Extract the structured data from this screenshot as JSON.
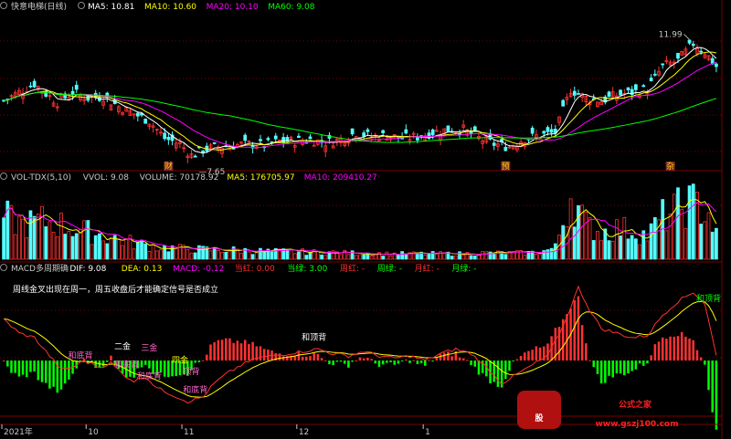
{
  "colors": {
    "bg": "#000000",
    "up": "#ff3232",
    "down": "#54fcfc",
    "grid": "#7a0000",
    "ma5": "#ffffff",
    "ma10": "#ffff00",
    "ma20": "#ff00ff",
    "ma60": "#00ff00",
    "dif": "#ffffff",
    "dea": "#ffff00"
  },
  "header_main": {
    "title": "快意电梯(日线)",
    "items": [
      {
        "text": "MA5: 10.81",
        "color": "#ffffff"
      },
      {
        "text": "MA10: 10.60",
        "color": "#ffff00"
      },
      {
        "text": "MA20: 10.10",
        "color": "#ff00ff"
      },
      {
        "text": "MA60: 9.08",
        "color": "#00ff00"
      }
    ]
  },
  "header_vol": {
    "items": [
      {
        "text": "VOL-TDX(5,10)",
        "color": "#c8c8c8"
      },
      {
        "text": "VVOL: 9.08",
        "color": "#c8c8c8"
      },
      {
        "text": "VOLUME: 70178.92",
        "color": "#c8c8c8"
      },
      {
        "text": "MA5: 176705.97",
        "color": "#ffff00"
      },
      {
        "text": "MA10: 209410.27",
        "color": "#ff00ff"
      }
    ]
  },
  "header_macd": {
    "items": [
      {
        "text": "MACD多周期确",
        "color": "#c8c8c8"
      },
      {
        "text": "DIF: 9.08",
        "color": "#ffffff"
      },
      {
        "text": "DEA: 0.13",
        "color": "#ffff00"
      },
      {
        "text": "MACD: -0.12",
        "color": "#ff00ff"
      },
      {
        "text": "当红: 0.00",
        "color": "#ff3232"
      },
      {
        "text": "当绿: 3.00",
        "color": "#00ff00"
      },
      {
        "text": "周红: -",
        "color": "#ff3232"
      },
      {
        "text": "周绿: -",
        "color": "#00ff00"
      },
      {
        "text": "月红: -",
        "color": "#ff3232"
      },
      {
        "text": "月绿: -",
        "color": "#00ff00"
      }
    ]
  },
  "macd_note": "周线金叉出现在周一，周五收盘后才能确定信号是否成立",
  "price_annotations": {
    "high": "11.99",
    "low": "7.65"
  },
  "event_markers": [
    {
      "label": "财",
      "i": 43
    },
    {
      "label": "预",
      "i": 131
    },
    {
      "label": "杂",
      "i": 174
    }
  ],
  "signal_labels": [
    {
      "text": "二金",
      "i": 31,
      "v": 0.5,
      "color": "#ffffff"
    },
    {
      "text": "三金",
      "i": 38,
      "v": 0.45,
      "color": "#ff66cc"
    },
    {
      "text": "四金",
      "i": 46,
      "v": -0.1,
      "color": "#ffff00"
    },
    {
      "text": "顶背",
      "i": 49,
      "v": -0.6,
      "color": "#ff66cc"
    },
    {
      "text": "和底背",
      "i": 20,
      "v": 0.1,
      "color": "#ff66cc"
    },
    {
      "text": "和底背",
      "i": 32,
      "v": -0.3,
      "color": "#ff66cc"
    },
    {
      "text": "和底背",
      "i": 38,
      "v": -0.8,
      "color": "#ff66cc"
    },
    {
      "text": "和底背",
      "i": 50,
      "v": -1.4,
      "color": "#ff66cc"
    },
    {
      "text": "和顶背",
      "i": 81,
      "v": 0.9,
      "color": "#ffffff"
    },
    {
      "text": "和顶背",
      "i": 184,
      "v": 2.6,
      "color": "#00ff00"
    }
  ],
  "date_axis": [
    {
      "label": "2021年",
      "i": 0
    },
    {
      "label": "10",
      "i": 22
    },
    {
      "label": "11",
      "i": 47
    },
    {
      "label": "12",
      "i": 77
    },
    {
      "label": "1",
      "i": 110
    }
  ],
  "watermark": {
    "badge": "股",
    "text": "公式之家",
    "url": "www.gszj100.com"
  },
  "chart_data": {
    "type": "candlestick",
    "n": 187,
    "price_ylim": [
      7.2,
      12.6
    ],
    "price_knots": [
      [
        0,
        9.6
      ],
      [
        4,
        9.9
      ],
      [
        8,
        10.2
      ],
      [
        11,
        9.85
      ],
      [
        14,
        9.55
      ],
      [
        18,
        9.9
      ],
      [
        22,
        9.7
      ],
      [
        26,
        9.75
      ],
      [
        30,
        9.4
      ],
      [
        34,
        9.15
      ],
      [
        38,
        8.9
      ],
      [
        42,
        8.3
      ],
      [
        46,
        8.1
      ],
      [
        49,
        7.7
      ],
      [
        52,
        7.9
      ],
      [
        56,
        8.0
      ],
      [
        60,
        8.05
      ],
      [
        64,
        8.1
      ],
      [
        68,
        8.05
      ],
      [
        72,
        8.2
      ],
      [
        76,
        8.2
      ],
      [
        80,
        8.25
      ],
      [
        84,
        8.15
      ],
      [
        88,
        8.25
      ],
      [
        92,
        8.5
      ],
      [
        96,
        8.35
      ],
      [
        100,
        8.4
      ],
      [
        104,
        8.3
      ],
      [
        108,
        8.35
      ],
      [
        112,
        8.5
      ],
      [
        116,
        8.6
      ],
      [
        120,
        8.6
      ],
      [
        124,
        8.3
      ],
      [
        128,
        8.1
      ],
      [
        132,
        8.0
      ],
      [
        136,
        8.3
      ],
      [
        140,
        8.4
      ],
      [
        144,
        8.5
      ],
      [
        148,
        10.0
      ],
      [
        152,
        9.7
      ],
      [
        156,
        9.6
      ],
      [
        160,
        9.8
      ],
      [
        164,
        9.9
      ],
      [
        168,
        10.0
      ],
      [
        172,
        10.8
      ],
      [
        176,
        11.0
      ],
      [
        180,
        11.6
      ],
      [
        183,
        11.3
      ],
      [
        186,
        10.8
      ]
    ],
    "vol_knots": [
      [
        0,
        0.55
      ],
      [
        5,
        0.45
      ],
      [
        10,
        0.5
      ],
      [
        15,
        0.45
      ],
      [
        20,
        0.38
      ],
      [
        25,
        0.32
      ],
      [
        30,
        0.26
      ],
      [
        35,
        0.2
      ],
      [
        40,
        0.16
      ],
      [
        45,
        0.14
      ],
      [
        50,
        0.13
      ],
      [
        55,
        0.12
      ],
      [
        60,
        0.12
      ],
      [
        65,
        0.11
      ],
      [
        70,
        0.1
      ],
      [
        75,
        0.1
      ],
      [
        80,
        0.09
      ],
      [
        85,
        0.09
      ],
      [
        90,
        0.08
      ],
      [
        95,
        0.08
      ],
      [
        100,
        0.07
      ],
      [
        105,
        0.07
      ],
      [
        110,
        0.07
      ],
      [
        115,
        0.07
      ],
      [
        120,
        0.07
      ],
      [
        125,
        0.08
      ],
      [
        130,
        0.08
      ],
      [
        135,
        0.08
      ],
      [
        140,
        0.09
      ],
      [
        144,
        0.15
      ],
      [
        148,
        0.85
      ],
      [
        152,
        0.45
      ],
      [
        156,
        0.35
      ],
      [
        160,
        0.4
      ],
      [
        164,
        0.38
      ],
      [
        168,
        0.3
      ],
      [
        172,
        0.55
      ],
      [
        176,
        0.65
      ],
      [
        180,
        0.75
      ],
      [
        184,
        0.6
      ],
      [
        186,
        0.3
      ]
    ],
    "dif_knots": [
      [
        0,
        1.8
      ],
      [
        4,
        1.2
      ],
      [
        8,
        1.0
      ],
      [
        12,
        0.2
      ],
      [
        15,
        -0.4
      ],
      [
        18,
        -0.3
      ],
      [
        21,
        0.0
      ],
      [
        25,
        -0.3
      ],
      [
        28,
        -0.1
      ],
      [
        31,
        -0.6
      ],
      [
        34,
        -0.9
      ],
      [
        37,
        -0.7
      ],
      [
        40,
        -1.2
      ],
      [
        44,
        -1.5
      ],
      [
        48,
        -1.8
      ],
      [
        52,
        -1.6
      ],
      [
        55,
        -1.0
      ],
      [
        58,
        -0.6
      ],
      [
        62,
        -0.2
      ],
      [
        66,
        0.1
      ],
      [
        70,
        0.2
      ],
      [
        74,
        0.3
      ],
      [
        78,
        0.4
      ],
      [
        82,
        0.5
      ],
      [
        86,
        0.3
      ],
      [
        90,
        0.2
      ],
      [
        94,
        0.4
      ],
      [
        98,
        0.2
      ],
      [
        102,
        0.1
      ],
      [
        106,
        0.2
      ],
      [
        110,
        0.0
      ],
      [
        114,
        0.3
      ],
      [
        118,
        0.5
      ],
      [
        122,
        0.3
      ],
      [
        126,
        -0.3
      ],
      [
        130,
        -1.0
      ],
      [
        134,
        -0.6
      ],
      [
        138,
        -0.2
      ],
      [
        142,
        0.2
      ],
      [
        146,
        1.5
      ],
      [
        150,
        3.2
      ],
      [
        153,
        2.2
      ],
      [
        156,
        1.4
      ],
      [
        160,
        1.2
      ],
      [
        164,
        1.0
      ],
      [
        168,
        1.1
      ],
      [
        172,
        2.0
      ],
      [
        176,
        2.6
      ],
      [
        180,
        3.0
      ],
      [
        183,
        2.5
      ],
      [
        186,
        0.2
      ]
    ],
    "macd_ylim": [
      -2.6,
      3.8
    ],
    "vol_max": 1.0
  }
}
